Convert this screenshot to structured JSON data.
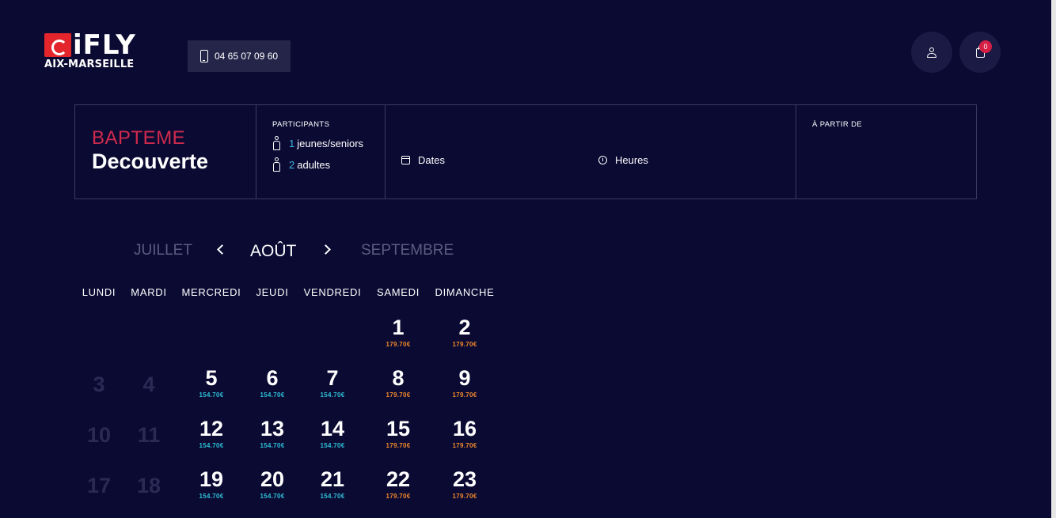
{
  "header": {
    "logo": {
      "word": "iFLY",
      "location": "AIX-MARSEILLE"
    },
    "phone": "04 65 07 09 60",
    "account_icon": "user-icon",
    "cart_icon": "shopping-bag-icon",
    "cart_count": "0"
  },
  "summary": {
    "product_category": "BAPTEME",
    "product_name": "Decouverte",
    "participants_label": "PARTICIPANTS",
    "participants": [
      {
        "count": "1",
        "label": "jeunes/seniors"
      },
      {
        "count": "2",
        "label": "adultes"
      }
    ],
    "dates_label": "Dates",
    "hours_label": "Heures",
    "from_label": "À PARTIR DE"
  },
  "calendar": {
    "prev_month": "JUILLET",
    "current_month": "AOÛT",
    "next_month": "SEPTEMBRE",
    "weekdays": [
      "LUNDI",
      "MARDI",
      "MERCREDI",
      "JEUDI",
      "VENDREDI",
      "SAMEDI",
      "DIMANCHE"
    ],
    "weeks": [
      [
        null,
        null,
        null,
        null,
        null,
        {
          "day": "1",
          "price": "179.70€",
          "tier": "high"
        },
        {
          "day": "2",
          "price": "179.70€",
          "tier": "high"
        }
      ],
      [
        {
          "day": "3",
          "past": true
        },
        {
          "day": "4",
          "past": true
        },
        {
          "day": "5",
          "price": "154.70€",
          "tier": "low"
        },
        {
          "day": "6",
          "price": "154.70€",
          "tier": "low"
        },
        {
          "day": "7",
          "price": "154.70€",
          "tier": "low"
        },
        {
          "day": "8",
          "price": "179.70€",
          "tier": "high"
        },
        {
          "day": "9",
          "price": "179.70€",
          "tier": "high"
        }
      ],
      [
        {
          "day": "10",
          "past": true
        },
        {
          "day": "11",
          "past": true
        },
        {
          "day": "12",
          "price": "154.70€",
          "tier": "low"
        },
        {
          "day": "13",
          "price": "154.70€",
          "tier": "low"
        },
        {
          "day": "14",
          "price": "154.70€",
          "tier": "low"
        },
        {
          "day": "15",
          "price": "179.70€",
          "tier": "high"
        },
        {
          "day": "16",
          "price": "179.70€",
          "tier": "high"
        }
      ],
      [
        {
          "day": "17",
          "past": true
        },
        {
          "day": "18",
          "past": true
        },
        {
          "day": "19",
          "price": "154.70€",
          "tier": "low"
        },
        {
          "day": "20",
          "price": "154.70€",
          "tier": "low"
        },
        {
          "day": "21",
          "price": "154.70€",
          "tier": "low"
        },
        {
          "day": "22",
          "price": "179.70€",
          "tier": "high"
        },
        {
          "day": "23",
          "price": "179.70€",
          "tier": "high"
        }
      ]
    ]
  },
  "colors": {
    "background": "#0b0a33",
    "accent_red": "#d02a4c",
    "price_low": "#2fc0d6",
    "price_high": "#f18a2a"
  }
}
